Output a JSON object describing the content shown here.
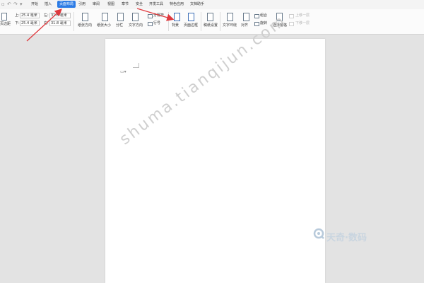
{
  "menubar": {
    "menus": [
      "开始",
      "插入",
      "页面布局",
      "引用",
      "审阅",
      "视图",
      "章节",
      "安全",
      "开发工具",
      "特色应用",
      "文档助手"
    ],
    "active_menu": "页面布局"
  },
  "ribbon": {
    "margins_label": "页边距",
    "margin_top_label": "上:",
    "margin_top_value": "25.4 毫米",
    "margin_bottom_label": "下:",
    "margin_bottom_value": "25.4 毫米",
    "margin_left_label": "左:",
    "margin_left_value": "31.8 毫米",
    "margin_right_label": "右:",
    "margin_right_value": "31.8 毫米",
    "orientation_label": "纸张方向",
    "size_label": "纸张大小",
    "columns_label": "分栏",
    "text_direction_label": "文字方向",
    "separator_label": "分隔符",
    "line_number_label": "行号",
    "background_label": "背景",
    "page_border_label": "页面边框",
    "draft_settings_label": "稿纸设置",
    "text_wrap_label": "文字环绕",
    "align_label": "对齐",
    "group_label": "组合",
    "rotate_label": "旋转",
    "select_pane_label": "选择窗格",
    "bring_forward_label": "上移一层",
    "send_backward_label": "下移一层"
  },
  "document": {
    "watermark": "shuma.tianqijun.com",
    "brand_logo_text": "天奇·数码"
  },
  "colors": {
    "accent": "#2c7be5",
    "annotation_arrow": "#e0393e"
  }
}
